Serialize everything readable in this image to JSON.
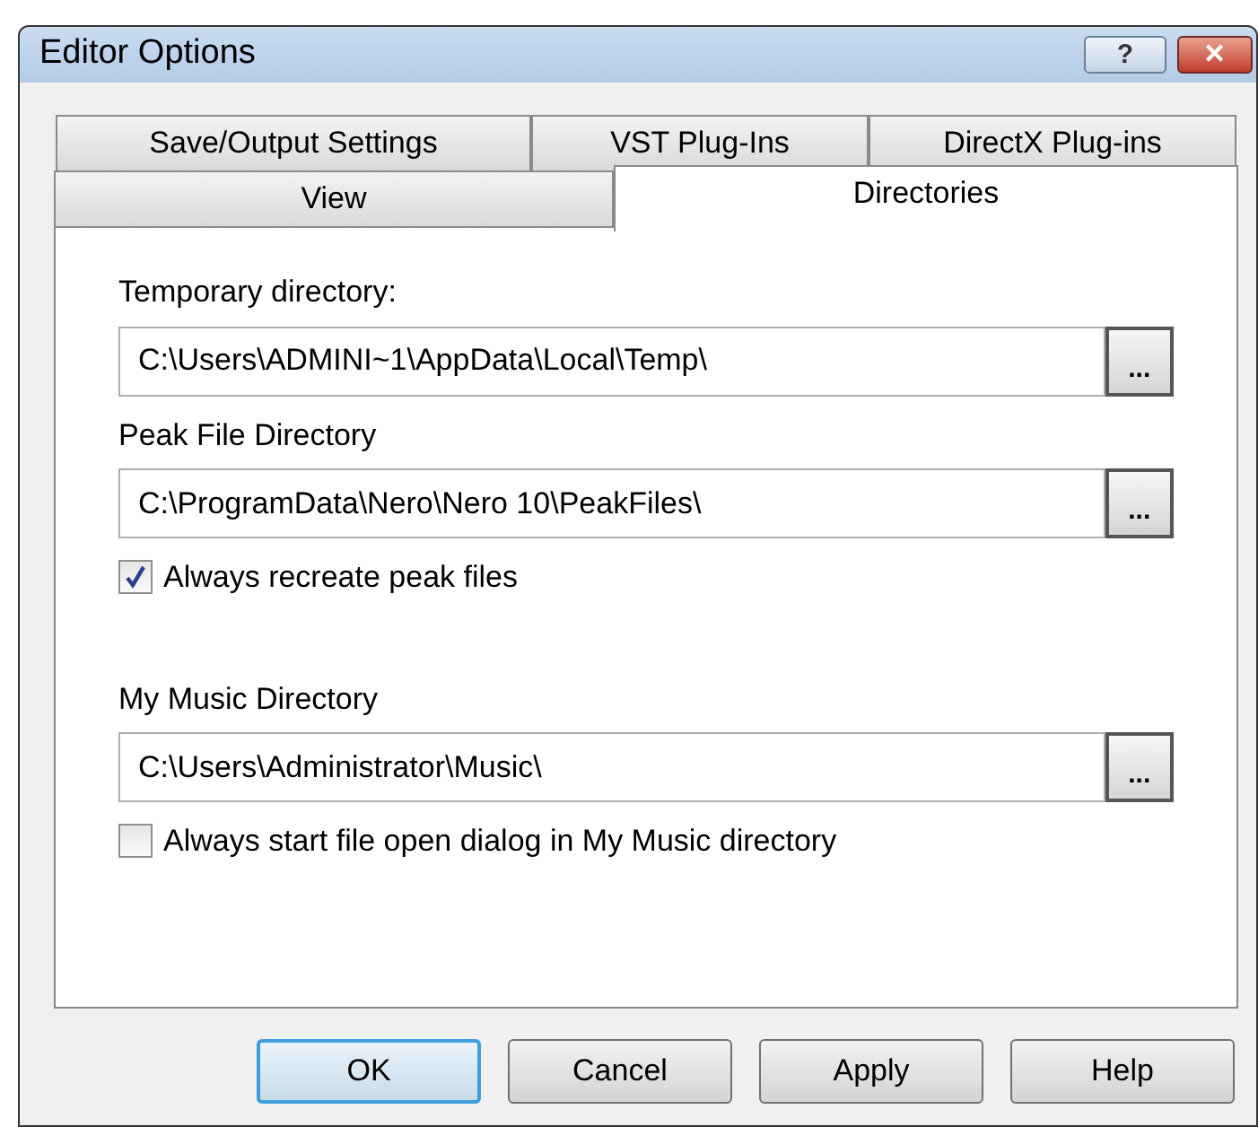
{
  "window": {
    "title": "Editor Options",
    "title_buttons": [
      {
        "kind": "help",
        "label": "?"
      },
      {
        "kind": "close",
        "label": "✕"
      }
    ]
  },
  "tab_rows": [
    [
      {
        "label": "Save/Output Settings",
        "selected": false
      },
      {
        "label": "VST Plug-Ins",
        "selected": false
      },
      {
        "label": "DirectX Plug-ins",
        "selected": false
      }
    ],
    [
      {
        "label": "View",
        "selected": false
      },
      {
        "label": "Directories",
        "selected": true
      }
    ]
  ],
  "items": [
    {
      "kind": "path",
      "label": "Temporary directory:",
      "value": "C:\\Users\\ADMINI~1\\AppData\\Local\\Temp\\",
      "browse": "..."
    },
    {
      "kind": "path",
      "label": "Peak File Directory",
      "value": "C:\\ProgramData\\Nero\\Nero 10\\PeakFiles\\",
      "browse": "..."
    },
    {
      "kind": "checkbox",
      "label": "Always recreate peak files",
      "checked": true
    },
    {
      "kind": "spacer"
    },
    {
      "kind": "path",
      "label": "My Music Directory",
      "value": "C:\\Users\\Administrator\\Music\\",
      "browse": "..."
    },
    {
      "kind": "checkbox",
      "label": "Always start file open dialog in My Music directory",
      "checked": false
    }
  ],
  "buttons": [
    {
      "label": "OK",
      "default": true
    },
    {
      "label": "Cancel",
      "default": false
    },
    {
      "label": "Apply",
      "default": false
    },
    {
      "label": "Help",
      "default": false
    }
  ]
}
